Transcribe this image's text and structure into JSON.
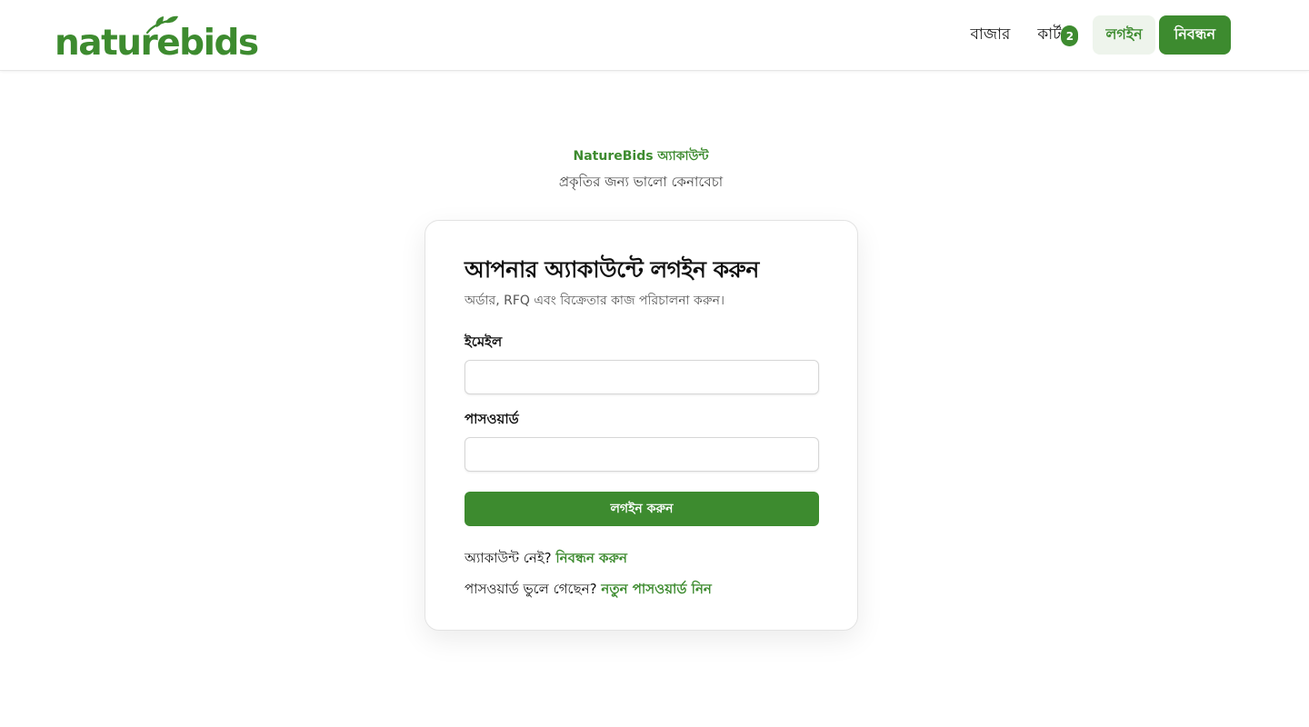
{
  "brand": {
    "logo_text": "naturebids",
    "accent_color": "#3d8b2f"
  },
  "nav": {
    "market_label": "বাজার",
    "cart_label": "কার্ট",
    "cart_count": "2",
    "login_label": "লগইন",
    "register_label": "নিবন্ধন"
  },
  "intro": {
    "eyebrow": "NatureBids অ্যাকাউন্ট",
    "tagline": "প্রকৃতির জন্য ভালো কেনাবেচা"
  },
  "login_card": {
    "title": "আপনার অ্যাকাউন্টে লগইন করুন",
    "subtitle": "অর্ডার, RFQ এবং বিক্রেতার কাজ পরিচালনা করুন।",
    "email_label": "ইমেইল",
    "email_value": "",
    "password_label": "পাসওয়ার্ড",
    "password_value": "",
    "submit_label": "লগইন করুন",
    "no_account_text": "অ্যাকাউন্ট নেই?",
    "register_link": "নিবন্ধন করুন",
    "forgot_text": "পাসওয়ার্ড ভুলে গেছেন?",
    "reset_link": "নতুন পাসওয়ার্ড নিন"
  },
  "icons": {
    "logo_leaf": "leaf-icon"
  }
}
